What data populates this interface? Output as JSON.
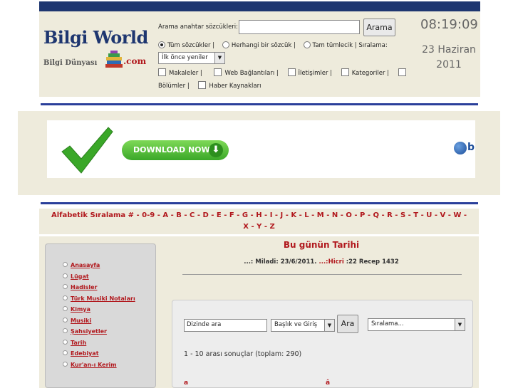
{
  "logo": {
    "brand": "Bilgi World",
    "tagline": "Bilgi Dünyası",
    "tld": ".com"
  },
  "search": {
    "label": "Arama anahtar sözcükleri:",
    "value": "",
    "button": "Arama",
    "radio_all": "Tüm sözcükler |",
    "radio_any": "Herhangi bir sözcük |",
    "radio_exact": "Tam tümlecik |",
    "sort_label": "Sıralama:",
    "sort_value": "İlk önce yeniler",
    "checks": [
      "Makaleler |",
      "Web Bağlantıları |",
      "İletişimler |",
      "Kategoriler |",
      "Bölümler |",
      "Haber Kaynakları"
    ]
  },
  "clock": {
    "time": "08:19:09",
    "day_month": "23 Haziran",
    "year": "2011"
  },
  "banner": {
    "download_label": "DOWNLOAD NOW",
    "side_letter": "b"
  },
  "alphabet": {
    "label": "Alfabetik Sıralama",
    "row1": [
      "#",
      "0-9",
      "A",
      "B",
      "C",
      "D",
      "E",
      "F",
      "G",
      "H",
      "I",
      "J",
      "K",
      "L",
      "M",
      "N",
      "O",
      "P",
      "Q",
      "R",
      "S",
      "T",
      "U",
      "V",
      "W"
    ],
    "row2": [
      "X",
      "Y",
      "Z"
    ]
  },
  "sidebar": {
    "items": [
      "Anasayfa",
      "Lügat",
      "Hadisler",
      "Türk Musiki Notaları",
      "Kimya",
      "Musiki",
      "Şahsiyetler",
      "Tarih",
      "Edebiyat",
      "Kur'an-ı Kerim"
    ]
  },
  "today": {
    "title": "Bu günün Tarihi",
    "miladi_label": "...: Miladi:",
    "miladi_value": "23/6/2011",
    "hicri_label": "...:Hicri",
    "hicri_value": ":22 Recep 1432"
  },
  "directory": {
    "input_value": "Dizinde ara",
    "field_select": "Başlık ve Giriş",
    "button": "Ara",
    "sort_select": "Sıralama...",
    "results_text": "1 - 10 arası sonuçlar (toplam: 290)",
    "letters": [
      "a",
      "â"
    ]
  },
  "colors": {
    "navy": "#1e3670",
    "accent_red": "#b1181d",
    "panel_beige": "#eeebdc"
  }
}
